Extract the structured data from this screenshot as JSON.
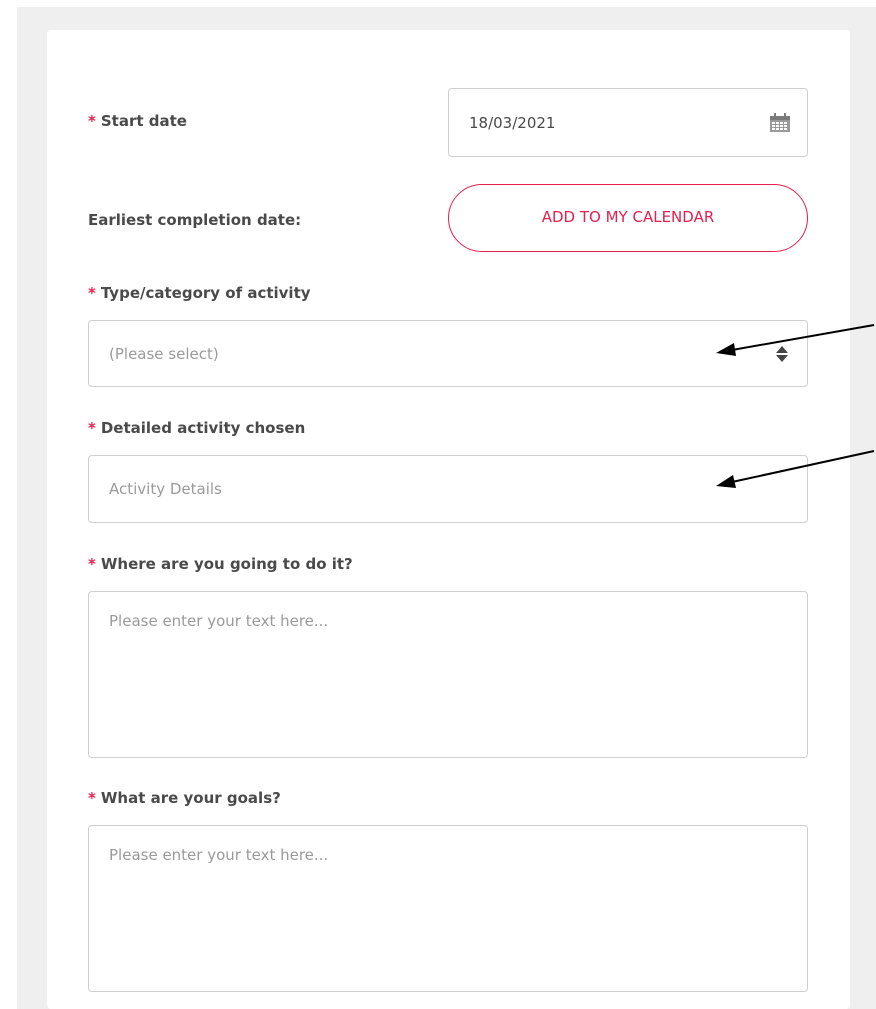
{
  "form": {
    "start_date": {
      "required_mark": "*",
      "label": "Start date",
      "value": "18/03/2021",
      "icon": "calendar-icon"
    },
    "completion": {
      "label": "Earliest completion date:",
      "button_label": "ADD TO MY CALENDAR"
    },
    "type_category": {
      "required_mark": "*",
      "label": "Type/category of activity",
      "placeholder": "(Please select)",
      "icon": "sort-arrows-icon"
    },
    "detailed_activity": {
      "required_mark": "*",
      "label": "Detailed activity chosen",
      "placeholder": "Activity Details"
    },
    "where": {
      "required_mark": "*",
      "label": "Where are you going to do it?",
      "placeholder": "Please enter your text here..."
    },
    "goals": {
      "required_mark": "*",
      "label": "What are your goals?",
      "placeholder": "Please enter your text here..."
    }
  },
  "colors": {
    "accent": "#e3204f",
    "label_text": "#4a4a4a",
    "placeholder_text": "#9a9a9a",
    "border": "#cfcfcf",
    "page_background": "#efefef",
    "annotation_arrow": "#000000"
  }
}
